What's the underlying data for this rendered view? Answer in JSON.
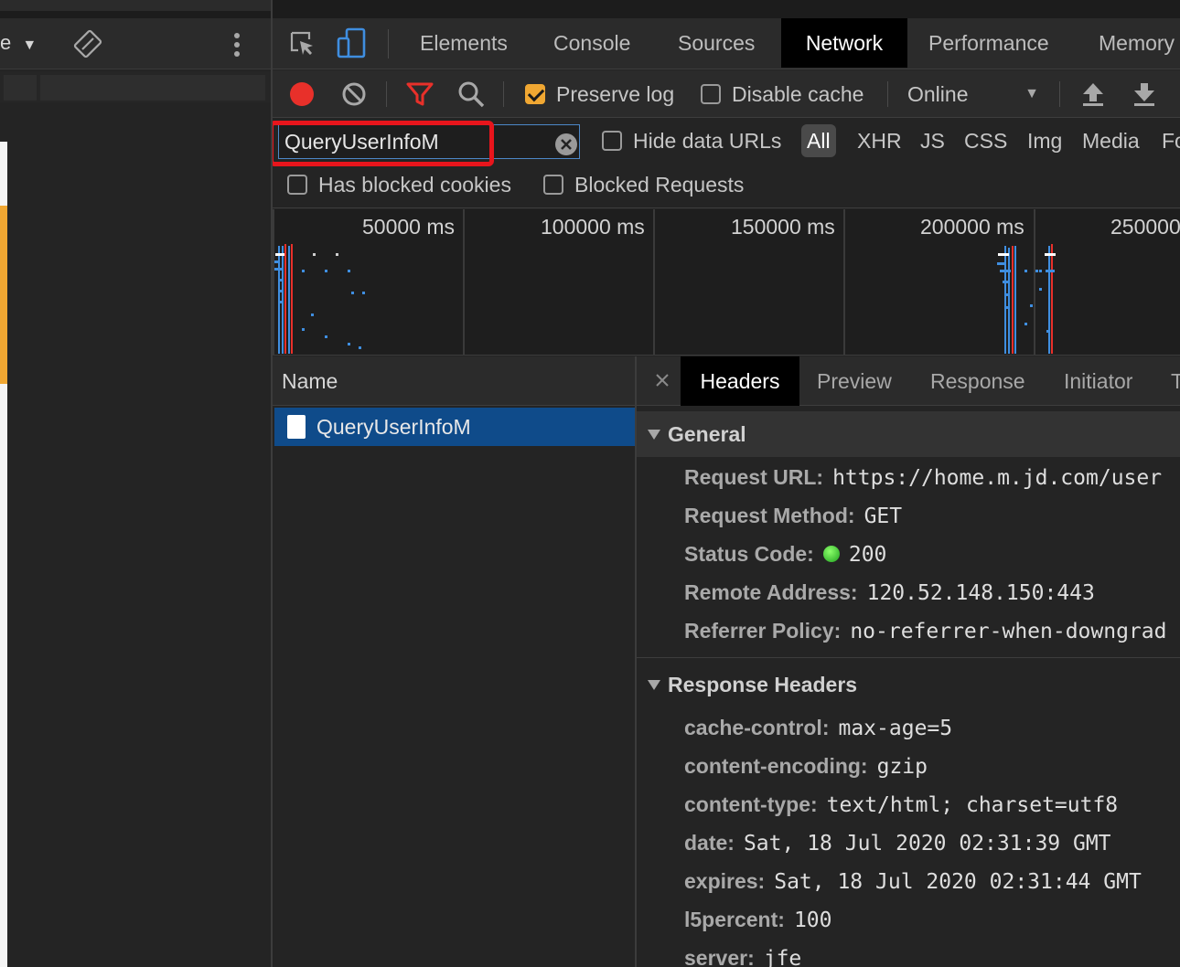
{
  "device_toolbar": {
    "device_label": "e"
  },
  "tabs": [
    "Elements",
    "Console",
    "Sources",
    "Network",
    "Performance",
    "Memory"
  ],
  "active_tab": "Network",
  "network_toolbar": {
    "preserve_log": {
      "label": "Preserve log",
      "checked": true
    },
    "disable_cache": {
      "label": "Disable cache",
      "checked": false
    },
    "throttling": "Online"
  },
  "filter": {
    "value": "QueryUserInfoM",
    "hide_data_urls": "Hide data URLs",
    "types": [
      "All",
      "XHR",
      "JS",
      "CSS",
      "Img",
      "Media",
      "Fo"
    ],
    "active_type": "All",
    "has_blocked_cookies": "Has blocked cookies",
    "blocked_requests": "Blocked Requests"
  },
  "overview": {
    "ticks": [
      "50000 ms",
      "100000 ms",
      "150000 ms",
      "200000 ms",
      "250000"
    ]
  },
  "request_list": {
    "column_name": "Name",
    "rows": [
      {
        "name": "QueryUserInfoM",
        "selected": true
      }
    ]
  },
  "details": {
    "close": "×",
    "tabs": [
      "Headers",
      "Preview",
      "Response",
      "Initiator",
      "T"
    ],
    "active_tab": "Headers",
    "general": {
      "title": "General",
      "rows": [
        {
          "key": "Request URL:",
          "value": "https://home.m.jd.com/user"
        },
        {
          "key": "Request Method:",
          "value": "GET"
        },
        {
          "key": "Status Code:",
          "value": "200",
          "status_color": "#2ecc40"
        },
        {
          "key": "Remote Address:",
          "value": "120.52.148.150:443"
        },
        {
          "key": "Referrer Policy:",
          "value": "no-referrer-when-downgrad"
        }
      ]
    },
    "response_headers": {
      "title": "Response Headers",
      "rows": [
        {
          "key": "cache-control:",
          "value": "max-age=5"
        },
        {
          "key": "content-encoding:",
          "value": "gzip"
        },
        {
          "key": "content-type:",
          "value": "text/html; charset=utf8"
        },
        {
          "key": "date:",
          "value": "Sat, 18 Jul 2020 02:31:39 GMT"
        },
        {
          "key": "expires:",
          "value": "Sat, 18 Jul 2020 02:31:44 GMT"
        },
        {
          "key": "l5percent:",
          "value": "100"
        },
        {
          "key": "server:",
          "value": "jfe"
        }
      ]
    }
  },
  "colors": {
    "accent_orange": "#f0a732",
    "record_red": "#e8302a",
    "selection_blue": "#0f4b8a",
    "highlight_red": "#e8151c"
  }
}
